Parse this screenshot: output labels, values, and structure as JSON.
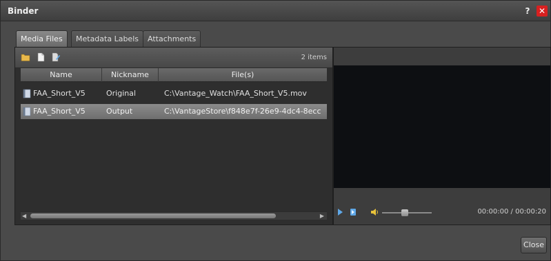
{
  "window": {
    "title": "Binder",
    "help_label": "?",
    "close_glyph": "✕"
  },
  "tabs": [
    {
      "label": "Media Files",
      "active": true
    },
    {
      "label": "Metadata Labels",
      "active": false
    },
    {
      "label": "Attachments",
      "active": false
    }
  ],
  "toolbar": {
    "items_count": "2 items",
    "icons": [
      "folder-icon",
      "new-document-icon",
      "edit-icon"
    ]
  },
  "table": {
    "columns": [
      "Name",
      "Nickname",
      "File(s)"
    ],
    "rows": [
      {
        "name": "FAA_Short_V5",
        "nickname": "Original",
        "file": "C:\\Vantage_Watch\\FAA_Short_V5.mov",
        "selected": false
      },
      {
        "name": "FAA_Short_V5",
        "nickname": "Output",
        "file": "C:\\VantageStore\\f848e7f-26e9-4dc4-8ecc",
        "selected": true
      }
    ]
  },
  "player": {
    "timecode": "00:00:00 / 00:00:20",
    "volume_level": 0.45
  },
  "footer": {
    "close_label": "Close"
  },
  "colors": {
    "accent_blue": "#5fa8e8",
    "close_red": "#d82020",
    "selected_row": "#7c7c7c",
    "video_bg": "#0d0f12"
  }
}
